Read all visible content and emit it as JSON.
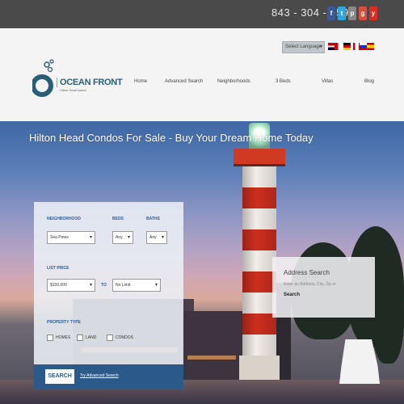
{
  "topbar": {
    "phone": "843 - 304 - 9590",
    "social": [
      {
        "name": "facebook-icon",
        "glyph": "f"
      },
      {
        "name": "twitter-icon",
        "glyph": "t"
      },
      {
        "name": "pinterest-icon",
        "glyph": "p"
      },
      {
        "name": "google-plus-icon",
        "glyph": "g"
      },
      {
        "name": "youtube-icon",
        "glyph": "y"
      }
    ]
  },
  "header": {
    "language_select": "Select Language",
    "logo_text": "OCEAN FRONT",
    "logo_sub": "Hilton Head Island",
    "nav": [
      "Home",
      "Advanced Search",
      "Neighborhoods",
      "3 Beds",
      "Villas",
      "Blog"
    ]
  },
  "hero": {
    "title": "Hilton Head Condos For Sale - Buy Your Dream Home Today"
  },
  "search_form": {
    "neighborhood_label": "NEIGHBORHOOD",
    "neighborhood_value": "Sea Pines",
    "beds_label": "BEDS",
    "beds_value": "Any",
    "baths_label": "BATHS",
    "baths_value": "Any",
    "list_price_label": "LIST PRICE",
    "min_price": "$100,000",
    "to_label": "TO",
    "max_price": "No Limit",
    "property_type_label": "PROPERTY TYPE",
    "types": [
      "HOMES",
      "LAND",
      "CONDOS"
    ],
    "search_button": "SEARCH",
    "advanced_link": "Try Advanced Search"
  },
  "address_search": {
    "title": "Address Search",
    "placeholder": "Enter an Address, City, Zip or",
    "button": "Search"
  },
  "colors": {
    "brand": "#2a5d78",
    "search_bar": "#2b5a8a",
    "topbar": "#4a4a4a"
  }
}
